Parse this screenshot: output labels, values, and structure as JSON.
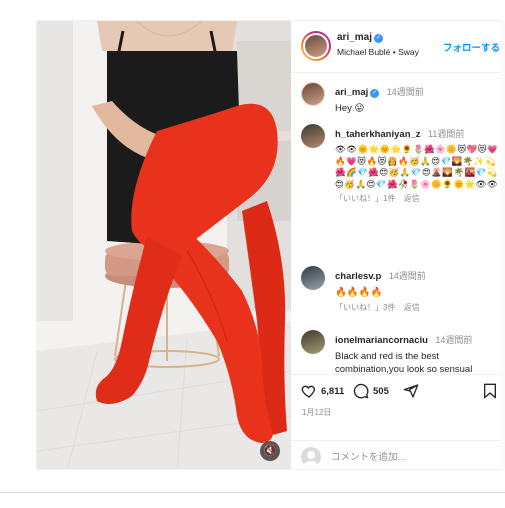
{
  "post": {
    "username": "ari_maj",
    "song": "Michael Bublé • Sway",
    "follow_label": "フォローする",
    "caption": {
      "username": "ari_maj",
      "time": "14週間前",
      "text": "Hey 😜"
    },
    "comments": [
      {
        "username": "h_taherkhaniyan_z",
        "time": "11週間前",
        "text": "👁👁🌞🌟🌞🌟🌻🌷🌺🌸🌼😻💖😻💗🔥💗😻🔥😻👸🔥🥳🙏😍💎🌄🌴✨💫🌺🌈💎🌺😍🥳🙏💎😍🌋🌄🌴🌇💎💫😍🥳🙏😍💎🌺🥀🌷🌸🌼🌻🌞🌟👁👁",
        "likes": "「いいね！」1件",
        "reply": "返信"
      },
      {
        "username": "charlesv.p",
        "time": "14週間前",
        "text": "🔥🔥🔥🔥",
        "likes": "「いいね！」3件",
        "reply": "返信"
      },
      {
        "username": "ionelmariancornaciu",
        "time": "14週間前",
        "text": "Black and red is the best combination,you look so sensual"
      }
    ],
    "like_count": "6,811",
    "comment_count": "505",
    "date": "1月12日",
    "add_comment_placeholder": "コメントを追加...",
    "icons": {
      "verified": "verified-badge-icon",
      "mute": "speaker-muted-icon",
      "like": "heart-icon",
      "comment": "comment-bubble-icon",
      "share": "paper-plane-icon",
      "save": "bookmark-icon"
    },
    "colors": {
      "link_blue": "#0095f6",
      "tights_red": "#e8321c",
      "muted_text": "#8e8e8e"
    }
  }
}
